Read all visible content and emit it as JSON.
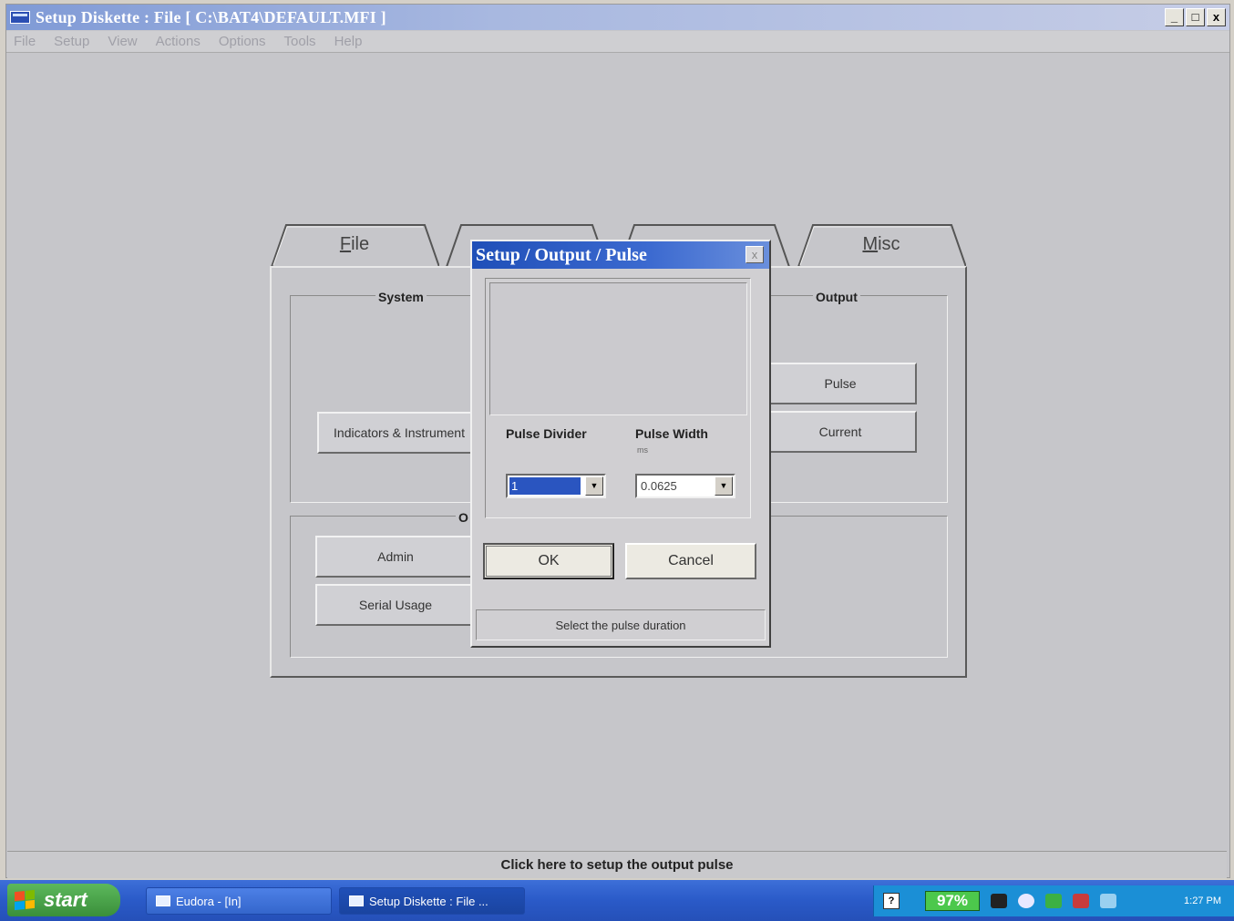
{
  "window": {
    "title": "Setup Diskette : File [ C:\\BAT4\\DEFAULT.MFI ]",
    "controls": [
      "_",
      "□",
      "x"
    ]
  },
  "menubar": [
    "File",
    "Setup",
    "View",
    "Actions",
    "Options",
    "Tools",
    "Help"
  ],
  "tabs": [
    {
      "label": "File",
      "accel": "F"
    },
    {
      "label": "",
      "accel": ""
    },
    {
      "label": "",
      "accel": ""
    },
    {
      "label": "Misc",
      "accel": "M"
    }
  ],
  "panel": {
    "system_group": {
      "title": "System",
      "buttons": [
        "Indicators & Instrument"
      ]
    },
    "output_group": {
      "title": "Output",
      "buttons": [
        "Pulse",
        "Current"
      ]
    },
    "other_group": {
      "title": "O",
      "buttons": [
        "Admin",
        "Serial Usage"
      ]
    }
  },
  "dialog": {
    "title": "Setup / Output / Pulse",
    "close": "x",
    "pulse_divider": {
      "label": "Pulse Divider",
      "value": "1"
    },
    "pulse_width": {
      "label": "Pulse Width",
      "unit": "ms",
      "value": "0.0625"
    },
    "ok_label": "OK",
    "cancel_label": "Cancel",
    "status": "Select the pulse duration"
  },
  "statusbar": {
    "text": "Click here to setup the output pulse"
  },
  "taskbar": {
    "start_label": "start",
    "tasks": [
      {
        "label": "Eudora - [In]",
        "active": false
      },
      {
        "label": "Setup Diskette : File ...",
        "active": true
      }
    ],
    "battery": "97%",
    "clock": "1:27 PM"
  }
}
